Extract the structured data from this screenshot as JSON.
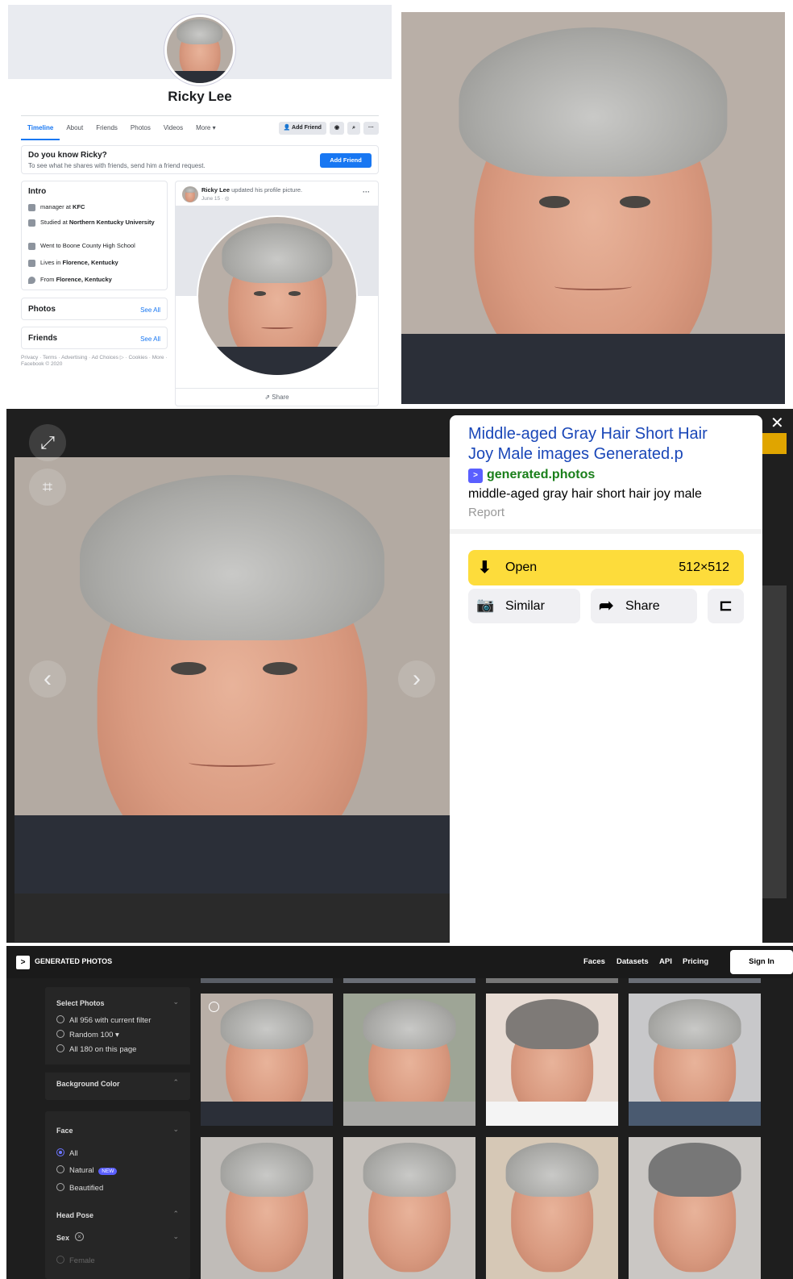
{
  "facebook": {
    "name": "Ricky Lee",
    "tabs": [
      "Timeline",
      "About",
      "Friends",
      "Photos",
      "Videos",
      "More ▾"
    ],
    "add_friend": "Add Friend",
    "more_dots": "···",
    "know_title": "Do you know Ricky?",
    "know_sub": "To see what he shares with friends, send him a friend request.",
    "know_btn": "Add Friend",
    "intro_title": "Intro",
    "intro": [
      {
        "pre": "manager at ",
        "bold": "KFC"
      },
      {
        "pre": "Studied at ",
        "bold": "Northern Kentucky University"
      },
      {
        "pre": "Went to Boone County High School",
        "bold": ""
      },
      {
        "pre": "Lives in ",
        "bold": "Florence, Kentucky"
      },
      {
        "pre": "From ",
        "bold": "Florence, Kentucky"
      }
    ],
    "photos_title": "Photos",
    "friends_title": "Friends",
    "see_all": "See All",
    "footer": "Privacy · Terms · Advertising · Ad Choices ▷ · Cookies · More · Facebook © 2020",
    "post_author": "Ricky Lee",
    "post_action": " updated his profile picture.",
    "post_date": "June 15 · ◎",
    "share": "Share"
  },
  "viewer": {
    "title": "Middle-aged Gray Hair Short Hair Joy Male images Generated.p",
    "site": "generated.photos",
    "description": "middle-aged gray hair short hair joy male",
    "report": "Report",
    "open": "Open",
    "size": "512×512",
    "similar": "Similar",
    "share": "Share",
    "close": "✕"
  },
  "gp": {
    "brand": "GENERATED PHOTOS",
    "nav": [
      "Faces",
      "Datasets",
      "API",
      "Pricing"
    ],
    "signin": "Sign In",
    "select_title": "Select Photos",
    "select_opts": [
      "All 956 with current filter",
      "Random 100 ▾",
      "All 180 on this page"
    ],
    "bg_title": "Background Color",
    "face_title": "Face",
    "face_opts": [
      "All",
      "Natural",
      "Beautified"
    ],
    "new_badge": "NEW",
    "head_title": "Head Pose",
    "sex_title": "Sex",
    "female": "Female"
  }
}
